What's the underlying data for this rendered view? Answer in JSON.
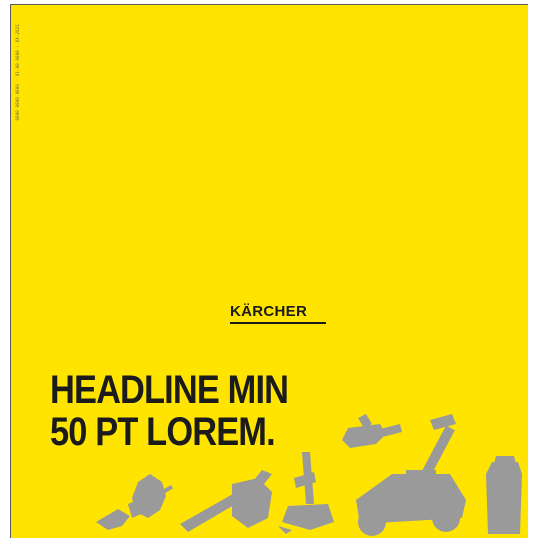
{
  "sidebar_note": "0000 0000 0000 · 01-00-0000 · XX-2021",
  "logo": "KÄRCHER",
  "headline": {
    "line1": "HEADLINE MIN",
    "line2": "50 PT LOREM."
  },
  "colors": {
    "background": "#ffe400",
    "text": "#1b1b1b",
    "silhouettes": "#9a9a9a"
  },
  "icons": [
    "leaf-blower-icon",
    "hand-blower-icon",
    "grass-trimmer-icon",
    "hedge-trimmer-icon",
    "lawn-mower-icon",
    "pressure-washer-icon"
  ]
}
